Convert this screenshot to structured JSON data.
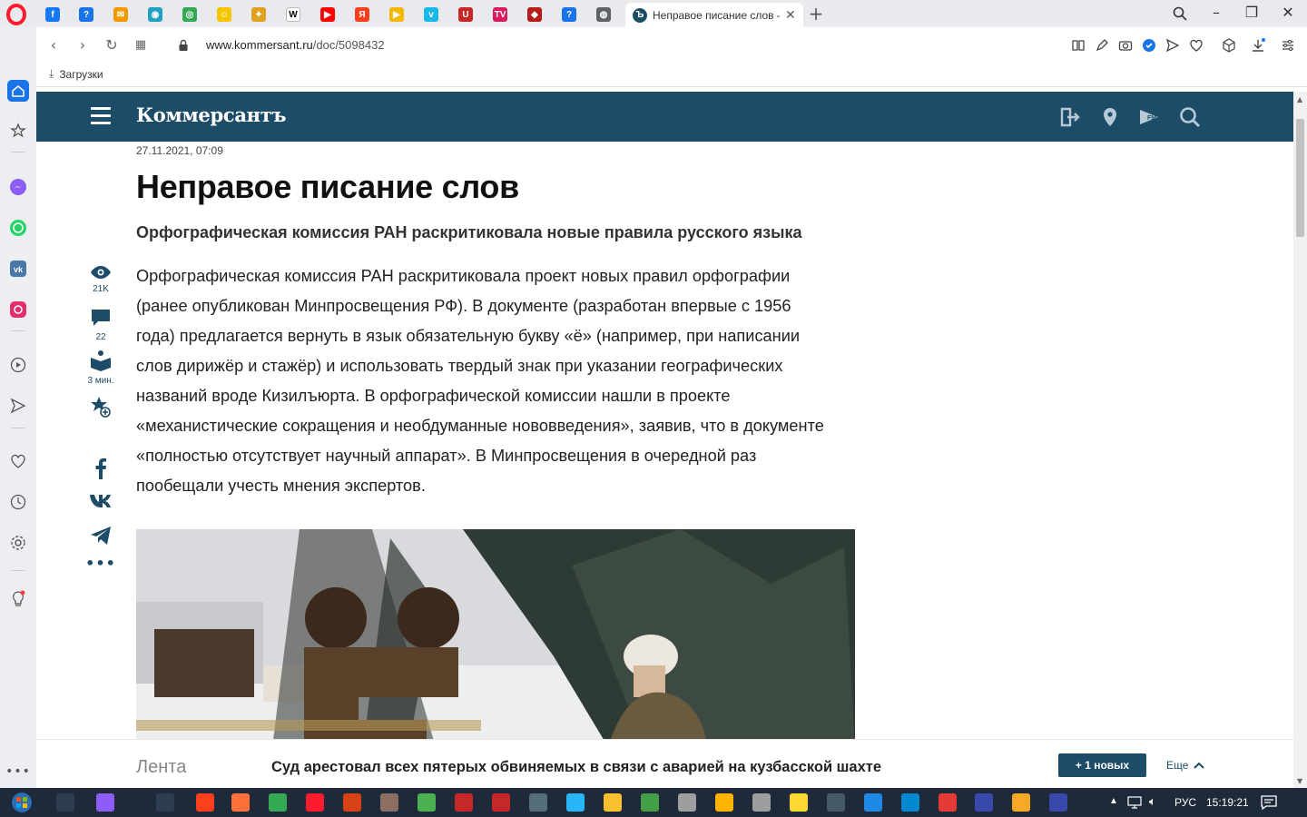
{
  "browser": {
    "active_tab_title": "Неправое писание слов –",
    "url_host": "www.kommersant.ru",
    "url_path": "/doc/5098432",
    "bookmarks": [
      {
        "label": "Загрузки"
      }
    ],
    "pinned_tabs": [
      {
        "icon": "facebook-icon",
        "color": "#1877f2",
        "glyph": "f"
      },
      {
        "icon": "help-icon",
        "color": "#1a73e8",
        "glyph": "?"
      },
      {
        "icon": "mail-icon",
        "color": "#f29900",
        "glyph": "✉"
      },
      {
        "icon": "site-icon",
        "color": "#20a0c0",
        "glyph": "◉"
      },
      {
        "icon": "site-icon",
        "color": "#34a853",
        "glyph": "◎"
      },
      {
        "icon": "smile-icon",
        "color": "#f6c600",
        "glyph": "☺"
      },
      {
        "icon": "game-icon",
        "color": "#e0a020",
        "glyph": "✦"
      },
      {
        "icon": "wikipedia-icon",
        "color": "#ffffff",
        "glyph": "W"
      },
      {
        "icon": "youtube-icon",
        "color": "#ff0000",
        "glyph": "▶"
      },
      {
        "icon": "yandex-icon",
        "color": "#fc3f1d",
        "glyph": "Я"
      },
      {
        "icon": "play-icon",
        "color": "#f5b800",
        "glyph": "▶"
      },
      {
        "icon": "vimeo-icon",
        "color": "#1ab7ea",
        "glyph": "v"
      },
      {
        "icon": "site-icon",
        "color": "#c62828",
        "glyph": "U"
      },
      {
        "icon": "tv-icon",
        "color": "#d81b60",
        "glyph": "TV"
      },
      {
        "icon": "site-icon",
        "color": "#b71c1c",
        "glyph": "◆"
      },
      {
        "icon": "help-icon",
        "color": "#1a73e8",
        "glyph": "?"
      },
      {
        "icon": "globe-icon",
        "color": "#5f6368",
        "glyph": "◍"
      }
    ]
  },
  "site": {
    "logo": "Коммерсантъ",
    "colors": {
      "header": "#1d4c68"
    }
  },
  "article": {
    "date": "27.11.2021, 07:09",
    "title": "Неправое писание слов",
    "subtitle": "Орфографическая комиссия РАН раскритиковала новые правила русского языка",
    "body_lines": [
      "Орфографическая комиссия РАН раскритиковала проект новых правил орфографии",
      "(ранее опубликован Минпросвещения РФ). В документе (разработан впервые с 1956",
      "года) предлагается вернуть в язык обязательную букву «ё» (например, при написании",
      "слов дирижёр и стажёр) и использовать твердый знак при указании географических",
      "названий вроде Кизилъюрта. В орфографической комиссии нашли в проекте",
      "«механистические сокращения и необдуманные нововведения», заявив, что в документе",
      "«полностью отсутствует научный аппарат». В Минпросвещения в очередной раз",
      "пообещали учесть мнения экспертов."
    ],
    "stats": {
      "views": "21K",
      "comments": "22",
      "read_time": "3 мин."
    }
  },
  "ticker": {
    "section": "Лента",
    "headline": "Суд арестовал всех пятерых обвиняемых в связи с аварией на кузбасской шахте",
    "new_button": "+ 1 новых",
    "more": "Еще"
  },
  "taskbar": {
    "language": "РУС",
    "time": "15:19:21"
  }
}
